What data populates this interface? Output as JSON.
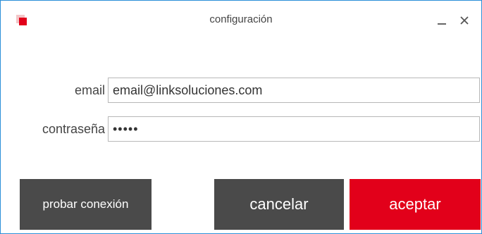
{
  "window": {
    "title": "configuración",
    "accent_color": "#e2001a",
    "border_color": "#2b8fd8",
    "minimize_icon": "minimize-icon",
    "close_icon": "close-icon",
    "close_glyph": "✕"
  },
  "form": {
    "email": {
      "label": "email",
      "value": "email@linksoluciones.com"
    },
    "password": {
      "label": "contraseña",
      "value": "•••••"
    }
  },
  "buttons": {
    "test_label": "probar conexión",
    "cancel_label": "cancelar",
    "accept_label": "aceptar",
    "dark_color": "#4a4a4a",
    "accept_color": "#e2001a"
  }
}
